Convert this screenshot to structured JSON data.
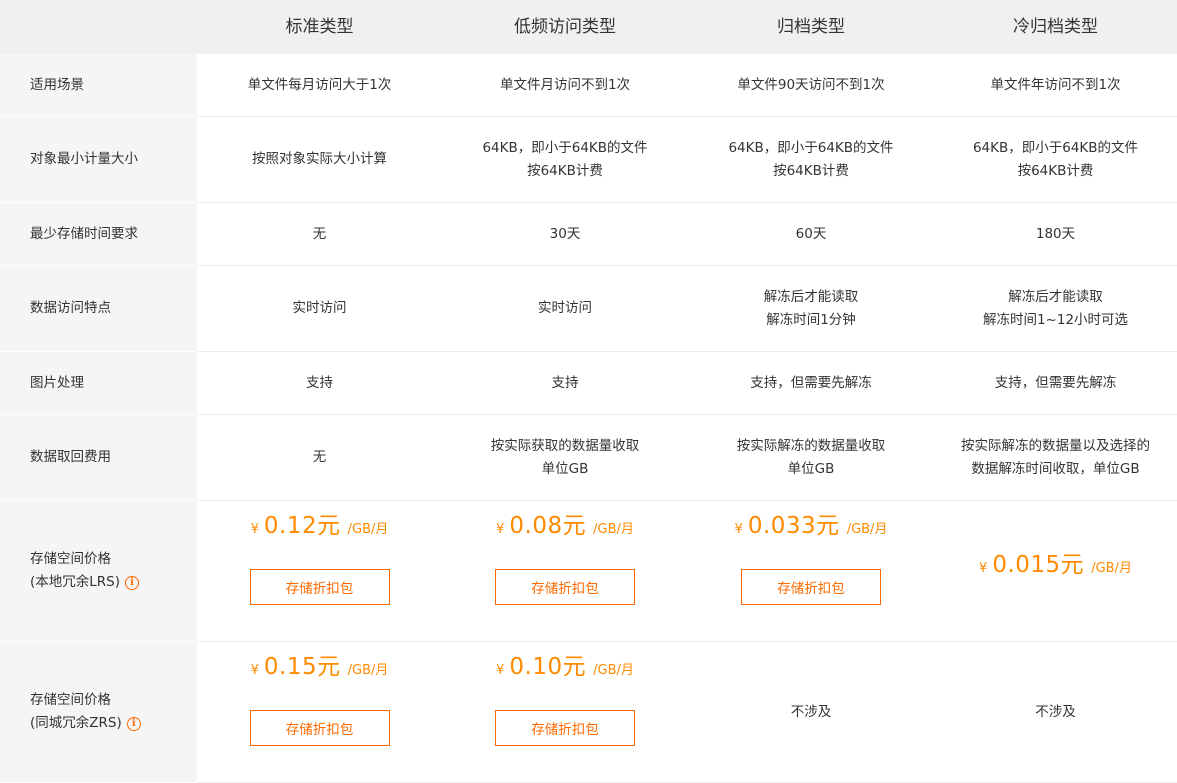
{
  "header": {
    "columns": [
      "标准类型",
      "低频访问类型",
      "归档类型",
      "冷归档类型"
    ]
  },
  "rows": {
    "scenario": {
      "label": "适用场景",
      "values": [
        "单文件每月访问大于1次",
        "单文件月访问不到1次",
        "单文件90天访问不到1次",
        "单文件年访问不到1次"
      ]
    },
    "min_size": {
      "label": "对象最小计量大小",
      "values": [
        [
          "按照对象实际大小计算"
        ],
        [
          "64KB，即小于64KB的文件",
          "按64KB计费"
        ],
        [
          "64KB，即小于64KB的文件",
          "按64KB计费"
        ],
        [
          "64KB，即小于64KB的文件",
          "按64KB计费"
        ]
      ]
    },
    "min_storage": {
      "label": "最少存储时间要求",
      "values": [
        "无",
        "30天",
        "60天",
        "180天"
      ]
    },
    "access": {
      "label": "数据访问特点",
      "values": [
        [
          "实时访问"
        ],
        [
          "实时访问"
        ],
        [
          "解冻后才能读取",
          "解冻时间1分钟"
        ],
        [
          "解冻后才能读取",
          "解冻时间1~12小时可选"
        ]
      ]
    },
    "image": {
      "label": "图片处理",
      "values": [
        "支持",
        "支持",
        "支持，但需要先解冻",
        "支持，但需要先解冻"
      ]
    },
    "retrieval": {
      "label": "数据取回费用",
      "values": [
        [
          "无"
        ],
        [
          "按实际获取的数据量收取",
          "单位GB"
        ],
        [
          "按实际解冻的数据量收取",
          "单位GB"
        ],
        [
          "按实际解冻的数据量以及选择的",
          "数据解冻时间收取，单位GB"
        ]
      ]
    },
    "lrs": {
      "label_line1": "存储空间价格",
      "label_line2": "(本地冗余LRS)",
      "info_icon": "info-icon",
      "currency": "¥",
      "unit": "/GB/月",
      "prices": [
        "0.12元",
        "0.08元",
        "0.033元",
        "0.015元"
      ],
      "button_label": "存储折扣包"
    },
    "zrs": {
      "label_line1": "存储空间价格",
      "label_line2": "(同城冗余ZRS)",
      "info_icon": "info-icon",
      "currency": "¥",
      "unit": "/GB/月",
      "prices": [
        "0.15元",
        "0.10元"
      ],
      "not_applicable": "不涉及",
      "button_label": "存储折扣包"
    }
  },
  "colors": {
    "accent": "#ff6a00",
    "price": "#ff8a00",
    "header_bg": "#f0f0f0",
    "label_bg": "#f5f5f5"
  }
}
